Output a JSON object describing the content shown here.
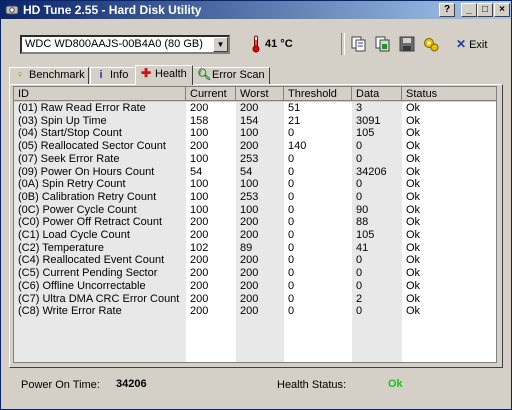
{
  "window": {
    "title": "HD Tune 2.55 - Hard Disk Utility",
    "controls": {
      "help": "?",
      "minimize": "_",
      "maximize": "□",
      "close": "×"
    }
  },
  "toolbar": {
    "drive": "WDC WD800AAJS-00B4A0 (80 GB)",
    "temperature": "41 °C",
    "exit_label": "Exit",
    "icons": [
      "copy-text-icon",
      "copy-image-icon",
      "save-icon",
      "options-icon"
    ]
  },
  "tabs": [
    {
      "label": "Benchmark",
      "icon": "thermometer-bench-icon"
    },
    {
      "label": "Info",
      "icon": "info-icon"
    },
    {
      "label": "Health",
      "icon": "health-cross-icon"
    },
    {
      "label": "Error Scan",
      "icon": "magnifier-icon"
    }
  ],
  "table": {
    "headers": [
      "ID",
      "Current",
      "Worst",
      "Threshold",
      "Data",
      "Status"
    ],
    "rows": [
      [
        "(01) Raw Read Error Rate",
        "200",
        "200",
        "51",
        "3",
        "Ok"
      ],
      [
        "(03) Spin Up Time",
        "158",
        "154",
        "21",
        "3091",
        "Ok"
      ],
      [
        "(04) Start/Stop Count",
        "100",
        "100",
        "0",
        "105",
        "Ok"
      ],
      [
        "(05) Reallocated Sector Count",
        "200",
        "200",
        "140",
        "0",
        "Ok"
      ],
      [
        "(07) Seek Error Rate",
        "100",
        "253",
        "0",
        "0",
        "Ok"
      ],
      [
        "(09) Power On Hours Count",
        "54",
        "54",
        "0",
        "34206",
        "Ok"
      ],
      [
        "(0A) Spin Retry Count",
        "100",
        "100",
        "0",
        "0",
        "Ok"
      ],
      [
        "(0B) Calibration Retry Count",
        "100",
        "253",
        "0",
        "0",
        "Ok"
      ],
      [
        "(0C) Power Cycle Count",
        "100",
        "100",
        "0",
        "90",
        "Ok"
      ],
      [
        "(C0) Power Off Retract Count",
        "200",
        "200",
        "0",
        "88",
        "Ok"
      ],
      [
        "(C1) Load Cycle Count",
        "200",
        "200",
        "0",
        "105",
        "Ok"
      ],
      [
        "(C2) Temperature",
        "102",
        "89",
        "0",
        "41",
        "Ok"
      ],
      [
        "(C4) Reallocated Event Count",
        "200",
        "200",
        "0",
        "0",
        "Ok"
      ],
      [
        "(C5) Current Pending Sector",
        "200",
        "200",
        "0",
        "0",
        "Ok"
      ],
      [
        "(C6) Offline Uncorrectable",
        "200",
        "200",
        "0",
        "0",
        "Ok"
      ],
      [
        "(C7) Ultra DMA CRC Error Count",
        "200",
        "200",
        "0",
        "2",
        "Ok"
      ],
      [
        "(C8) Write Error Rate",
        "200",
        "200",
        "0",
        "0",
        "Ok"
      ]
    ]
  },
  "status": {
    "power_on_label": "Power On Time:",
    "power_on_value": "34206",
    "health_label": "Health Status:",
    "health_value": "Ok"
  },
  "colors": {
    "title_start": "#0a246a",
    "title_end": "#a6caf0",
    "ok_green": "#18c418",
    "face": "#d4d0c8"
  }
}
